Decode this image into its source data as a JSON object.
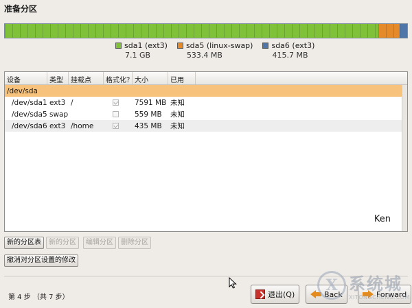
{
  "window": {
    "title": "准备分区"
  },
  "disk_bar": {
    "segments": [
      {
        "name": "sda1",
        "fraction": 0.9277,
        "color": "#7fc23a"
      },
      {
        "name": "sda5",
        "fraction": 0.053,
        "color": "#e58a2b"
      },
      {
        "name": "sda6",
        "fraction": 0.0193,
        "color": "#4e76a8"
      }
    ]
  },
  "legend": [
    {
      "label": "sda1 (ext3)",
      "size": "7.1 GB",
      "color": "#7fc23a"
    },
    {
      "label": "sda5 (linux-swap)",
      "size": "533.4 MB",
      "color": "#e58a2b"
    },
    {
      "label": "sda6 (ext3)",
      "size": "415.7 MB",
      "color": "#4e76a8"
    }
  ],
  "table": {
    "headers": [
      "设备",
      "类型",
      "挂载点",
      "格式化？",
      "大小",
      "已用"
    ],
    "disk": "/dev/sda",
    "rows": [
      {
        "device": "/dev/sda1",
        "type": "ext3",
        "mount": "/",
        "format": true,
        "size": "7591 MB",
        "used": "未知"
      },
      {
        "device": "/dev/sda5",
        "type": "swap",
        "mount": "",
        "format": false,
        "size": "559 MB",
        "used": "未知"
      },
      {
        "device": "/dev/sda6",
        "type": "ext3",
        "mount": "/home",
        "format": true,
        "size": "435 MB",
        "used": "未知"
      }
    ],
    "signature": "Ken"
  },
  "buttons": {
    "new_table": "新的分区表",
    "new_partition": "新的分区",
    "edit_partition": "编辑分区",
    "delete_partition": "删除分区",
    "undo_changes": "撤消对分区设置的修改"
  },
  "footer": {
    "step": "第 4 步 （共 7 步）",
    "quit": "退出(Q)",
    "back": "Back",
    "forward": "Forward"
  },
  "watermark": {
    "title": "系统城",
    "subtitle": "XITONGCHENG.COM"
  }
}
